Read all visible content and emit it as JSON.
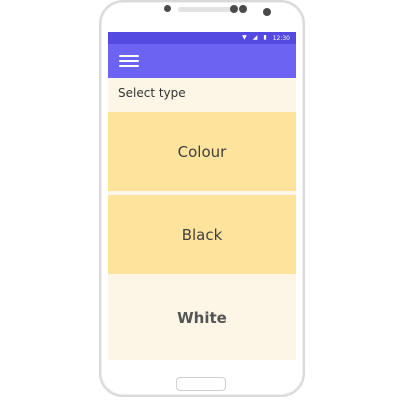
{
  "status_bar": {
    "time": "12:30",
    "icons": [
      "wifi-icon",
      "signal-icon",
      "battery-icon"
    ]
  },
  "app_bar": {
    "menu_icon": "hamburger-menu-icon",
    "color": "#6c63f3"
  },
  "subtitle": "Select type",
  "options": [
    {
      "label": "Colour",
      "color": "#fde39c"
    },
    {
      "label": "Black",
      "color": "#fde39c"
    },
    {
      "label": "White",
      "color": "#fdf5e6"
    }
  ]
}
